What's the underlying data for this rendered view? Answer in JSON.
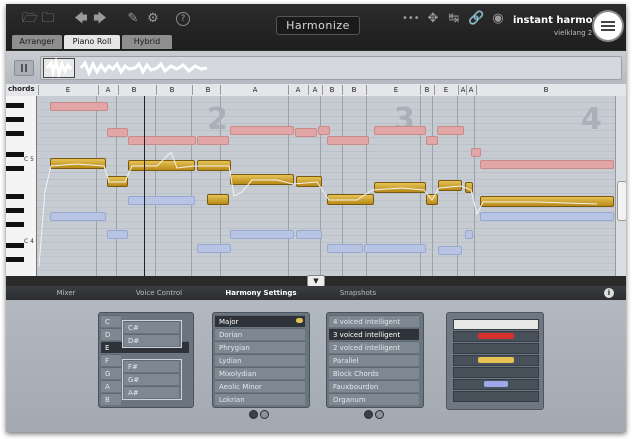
{
  "app": {
    "title": "Harmonize",
    "brand": "instant harmony",
    "brand_sub": "vielklang 2",
    "colors": {
      "accent_gold": "#e6c256",
      "harmony_red": "#e3a6a6",
      "harmony_blue": "#b8c4e4"
    }
  },
  "toolbar": {
    "icons": [
      "folder-open-icon",
      "folder-save-icon",
      "undo-icon",
      "redo-icon",
      "edit-icon",
      "gear-icon",
      "help-icon"
    ],
    "right_icons": [
      "link-icon",
      "move-icon",
      "split-icon",
      "chain-icon",
      "record-icon"
    ]
  },
  "tabs": [
    {
      "label": "Arranger"
    },
    {
      "label": "Piano Roll"
    },
    {
      "label": "Hybrid"
    }
  ],
  "active_tab": "Piano Roll",
  "piano_roll": {
    "chords_label": "chords",
    "chords": [
      "E",
      "A",
      "B",
      "B",
      "B",
      "A",
      "A",
      "A",
      "B",
      "B",
      "E",
      "B",
      "E",
      "A",
      "A",
      "B"
    ],
    "bar_numbers": [
      "2",
      "3",
      "4"
    ],
    "octave_labels": [
      "C 5",
      "C 4"
    ]
  },
  "bottom": {
    "subtabs": [
      "Mixer",
      "Voice Control",
      "Harmony Settings",
      "Snapshots"
    ],
    "active_subtab": "Harmony Settings",
    "key_list": {
      "items": [
        "C",
        "D",
        "E",
        "F",
        "G",
        "A",
        "B"
      ],
      "selected": "E",
      "sharps_upper": [
        "C#",
        "D#"
      ],
      "sharps_lower": [
        "F#",
        "G#",
        "A#"
      ]
    },
    "scale_list": {
      "items": [
        "Major",
        "Dorian",
        "Phrygian",
        "Lydian",
        "Mixolydian",
        "Aeolic Minor",
        "Lokrian"
      ],
      "selected": "Major"
    },
    "voicing_list": {
      "items": [
        "4 voiced intelligent",
        "3 voiced intelligent",
        "2 voiced intelligent",
        "Parallel",
        "Block Chords",
        "Fauxbourdon",
        "Organum"
      ],
      "selected": "3 voiced intelligent"
    }
  }
}
